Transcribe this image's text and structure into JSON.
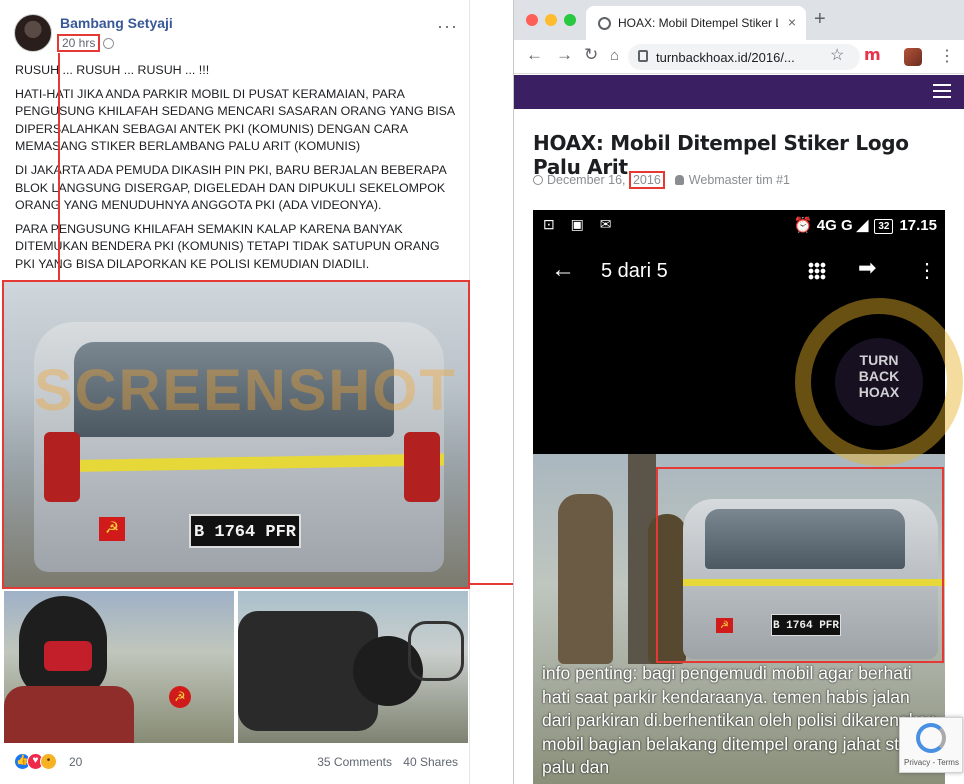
{
  "facebook": {
    "author": "Bambang Setyaji",
    "time": "20 hrs",
    "more": "···",
    "paragraphs": [
      "RUSUH ... RUSUH ... RUSUH ... !!!",
      "HATI-HATI JIKA ANDA PARKIR MOBIL DI PUSAT KERAMAIAN, PARA PENGUSUNG KHILAFAH SEDANG MENCARI SASARAN ORANG YANG BISA DIPERSALAHKAN SEBAGAI ANTEK PKI (KOMUNIS) DENGAN CARA MEMASANG STIKER BERLAMBANG PALU ARIT (KOMUNIS)",
      "DI JAKARTA ADA PEMUDA DIKASIH PIN PKI, BARU BERJALAN BEBERAPA BLOK LANGSUNG DISERGAP, DIGELEDAH DAN DIPUKULI SEKELOMPOK ORANG YANG MENUDUHNYA ANGGOTA PKI (ADA VIDEONYA).",
      "PARA PENGUSUNG KHILAFAH SEMAKIN KALAP KARENA BANYAK DITEMUKAN BENDERA PKI (KOMUNIS) TETAPI TIDAK SATUPUN ORANG PKI YANG BISA DILAPORKAN KE POLISI KEMUDIAN DIADILI."
    ],
    "plate": "B 1764 PFR",
    "watermark": "SCREENSHOT BY",
    "reaction_count": "20",
    "comments": "35 Comments",
    "shares": "40 Shares"
  },
  "browser": {
    "tab_title": "HOAX: Mobil Ditempel Stiker Lo",
    "tab_close": "×",
    "new_tab": "+",
    "url": "turnbackhoax.id/2016/...",
    "article": {
      "title": "HOAX: Mobil Ditempel Stiker Logo Palu Arit",
      "date_prefix": "December 16, ",
      "date_year": "2016",
      "author": "Webmaster tim #1"
    },
    "phone": {
      "status_left": "⊡ ▣ ✉",
      "network": "⏰ 4G G ◢",
      "battery": "32",
      "clock": "17.15",
      "gallery_title": "5 dari 5",
      "plate": "B 1764 PFR",
      "caption": "info penting: bagi pengemudi mobil agar berhati hati saat parkir kendaraanya. temen habis jalan dari parkiran di.berhentikan oleh polisi dikarenakan mobil bagian belakang ditempel orang jahat stiker palu dan"
    },
    "badge_text": "TURN BACK HOAX",
    "recaptcha": "Privacy - Terms"
  },
  "colors": {
    "highlight": "#e53935",
    "fb_link": "#385898",
    "site_bar": "#3b1f63"
  }
}
